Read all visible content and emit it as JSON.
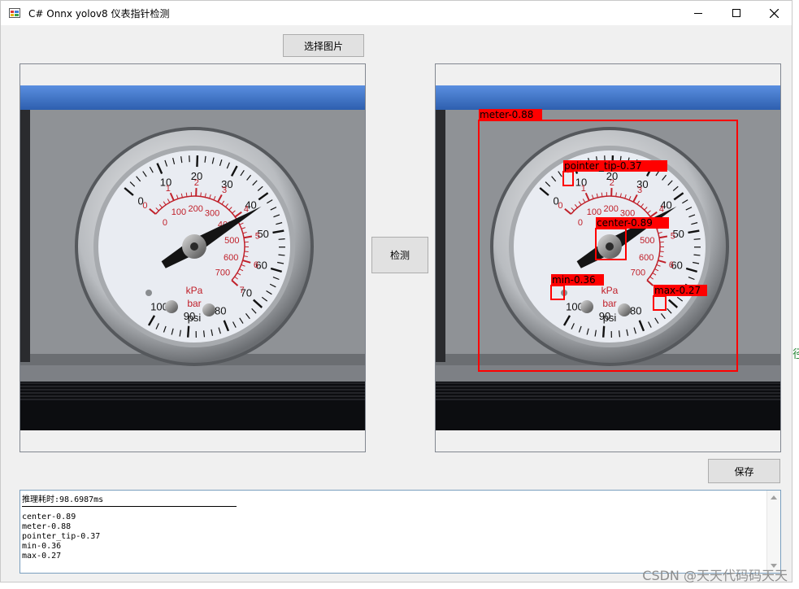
{
  "window": {
    "title": "C# Onnx yolov8 仪表指针检测",
    "controls": [
      "minimize-icon",
      "maximize-icon",
      "close-icon"
    ]
  },
  "buttons": {
    "select_image": "选择图片",
    "detect": "检测",
    "save": "保存"
  },
  "gauge": {
    "psi_ticks": [
      "0",
      "10",
      "20",
      "30",
      "40",
      "50",
      "60",
      "70",
      "80",
      "90",
      "100"
    ],
    "bar_ticks": [
      "0",
      "1",
      "2",
      "3",
      "4",
      "5",
      "6",
      "7"
    ],
    "kpa_ticks": [
      "0",
      "100",
      "200",
      "300",
      "400",
      "500",
      "600",
      "700"
    ],
    "unit_kpa": "kPa",
    "unit_bar": "bar",
    "unit_psi": "psi",
    "pointer_psi_value": 42
  },
  "detections": [
    {
      "label": "meter-0.88",
      "name": "meter",
      "score": 0.88
    },
    {
      "label": "pointer_tip-0.37",
      "name": "pointer_tip",
      "score": 0.37
    },
    {
      "label": "center-0.89",
      "name": "center",
      "score": 0.89
    },
    {
      "label": "min-0.36",
      "name": "min",
      "score": 0.36
    },
    {
      "label": "max-0.27",
      "name": "max",
      "score": 0.27
    }
  ],
  "log": {
    "timing": "推理耗时:98.6987ms",
    "lines": [
      "center-0.89",
      "meter-0.88",
      "pointer_tip-0.37",
      "min-0.36",
      "max-0.27"
    ]
  },
  "edge_glyph": "径",
  "watermark": "CSDN @天天代码码天天",
  "colors": {
    "detection_box": "#ff0000",
    "detection_text": "#000000"
  }
}
